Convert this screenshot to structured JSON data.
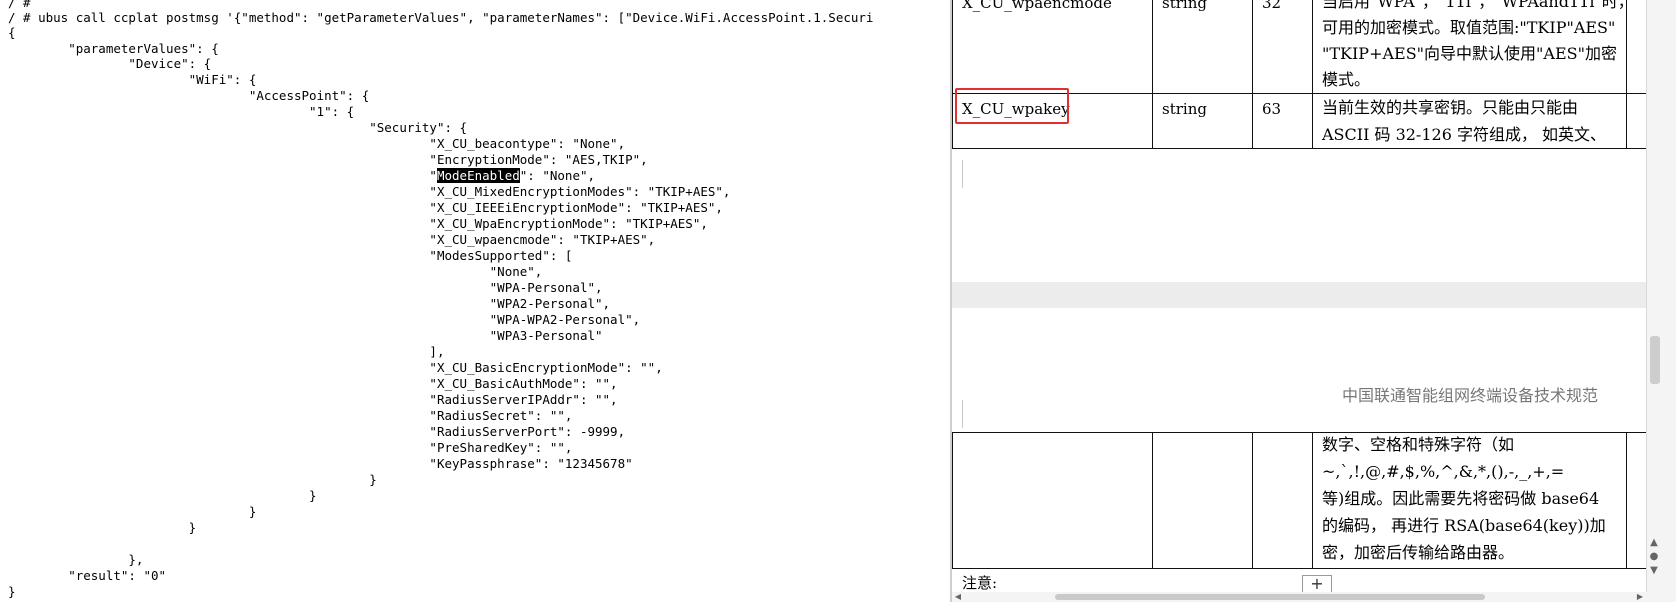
{
  "terminal": {
    "lines": [
      "/ #",
      "/ # ubus call ccplat postmsg '{\"method\": \"getParameterValues\", \"parameterNames\": [\"Device.WiFi.AccessPoint.1.Securi",
      "{",
      "        \"parameterValues\": {",
      "                \"Device\": {",
      "                        \"WiFi\": {",
      "                                \"AccessPoint\": {",
      "                                        \"1\": {",
      "                                                \"Security\": {",
      "                                                        \"X_CU_beacontype\": \"None\",",
      "                                                        \"EncryptionMode\": \"AES,TKIP\",",
      "                                                        \"",
      "                                                        \"X_CU_MixedEncryptionModes\": \"TKIP+AES\",",
      "                                                        \"X_CU_IEEEiEncryptionMode\": \"TKIP+AES\",",
      "                                                        \"X_CU_WpaEncryptionMode\": \"TKIP+AES\",",
      "                                                        \"X_CU_wpaencmode\": \"TKIP+AES\",",
      "                                                        \"ModesSupported\": [",
      "                                                                \"None\",",
      "                                                                \"WPA-Personal\",",
      "                                                                \"WPA2-Personal\",",
      "                                                                \"WPA-WPA2-Personal\",",
      "                                                                \"WPA3-Personal\"",
      "                                                        ],",
      "                                                        \"X_CU_BasicEncryptionMode\": \"\",",
      "                                                        \"X_CU_BasicAuthMode\": \"\",",
      "                                                        \"RadiusServerIPAddr\": \"\",",
      "                                                        \"RadiusSecret\": \"\",",
      "                                                        \"RadiusServerPort\": -9999,",
      "                                                        \"PreSharedKey\": \"\",",
      "                                                        \"KeyPassphrase\": \"12345678\"",
      "                                                }",
      "                                        }",
      "                                }",
      "                        }",
      "                },",
      "        \"result\": \"0\"",
      "}"
    ],
    "highlight_word": "ModeEnabled",
    "highlight_suffix": "\": \"None\","
  },
  "doc": {
    "row_top": {
      "name": "X_CU_wpaencmode",
      "type": "string",
      "length": "32",
      "desc_lines": [
        "当启用\"WPA\"，\"11i\"，\"WPAand11i\"时，",
        "可用的加密模式。取值范围:\"TKIP\"AES\"",
        "\"TKIP+AES\"向导中默认使用\"AES\"加密",
        "模式。"
      ]
    },
    "row_key": {
      "name": "X_CU_wpakey",
      "type": "string",
      "length": "63",
      "desc_lines": [
        "当前生效的共享密钥。只能由只能由",
        "ASCII 码 32-126 字符组成， 如英文、"
      ]
    },
    "footer": "中国联通智能组网终端设备技术规范",
    "row_cont": {
      "desc_lines": [
        "数字、空格和特殊字符（如",
        "~,`,!,@,#,$,%,^,&,*,(),-,_,+,=",
        "等)组成。因此需要先将密码做 base64",
        "的编码， 再进行 RSA(base64(key))加",
        "密，加密后传输给路由器。"
      ]
    },
    "note": "注意:",
    "plus": "+"
  },
  "colors": {
    "highlight_bg": "#000000",
    "red_box": "#e03030"
  }
}
